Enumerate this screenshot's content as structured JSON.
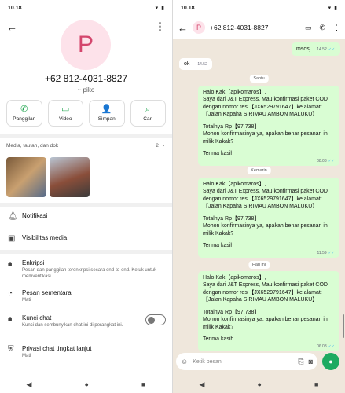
{
  "left": {
    "status": {
      "time": "10.18"
    },
    "avatar_letter": "P",
    "phone": "+62 812-4031-8827",
    "alias": "~ piko",
    "actions": [
      {
        "icon": "phone-icon",
        "glyph": "✆",
        "label": "Panggilan"
      },
      {
        "icon": "video-icon",
        "glyph": "▭",
        "label": "Video"
      },
      {
        "icon": "add-contact-icon",
        "glyph": "👤",
        "label": "Simpan"
      },
      {
        "icon": "search-icon",
        "glyph": "⌕",
        "label": "Cari"
      }
    ],
    "media": {
      "label": "Media, tautan, dan dok",
      "count": "2"
    },
    "settings": [
      {
        "icon": "bell-icon",
        "title": "Notifikasi",
        "subtitle": ""
      },
      {
        "icon": "image-icon",
        "title": "Visibilitas media",
        "subtitle": ""
      },
      {
        "icon": "lock-icon",
        "title": "Enkripsi",
        "subtitle": "Pesan dan panggilan terenkripsi secara end-to-end. Ketuk untuk memverifikasi."
      },
      {
        "icon": "timer-icon",
        "title": "Pesan sementara",
        "subtitle": "Mati"
      },
      {
        "icon": "chat-lock-icon",
        "title": "Kunci chat",
        "subtitle": "Kunci dan sembunyikan chat ini di perangkat ini."
      },
      {
        "icon": "shield-icon",
        "title": "Privasi chat tingkat lanjut",
        "subtitle": "Mati"
      }
    ]
  },
  "right": {
    "status": {
      "time": "10.18"
    },
    "contact": "+62 812-4031-8827",
    "avatar_letter": "P",
    "messages": {
      "m1": {
        "text": "msosj",
        "time": "14.52"
      },
      "m2": {
        "text": "ok",
        "time": "14.52"
      },
      "date1": "Sabtu",
      "date2": "Kemarin",
      "date3": "Hari ini",
      "order_greeting": "Halo Kak【apikomaros】,",
      "order_line1": "Saya dari J&T Express, Mau konfirmasi paket COD dengan nomor resi【JX6529791647】ke alamat:",
      "order_line2": "【Jalan Kapaha  SIRIMAU AMBON MALUKU】",
      "order_total": "Totalnya Rp【97,738】",
      "order_q": "Mohon konfirmasinya ya, apakah benar pesanan ini milik Kakak?",
      "order_thanks": "Terima kasih",
      "t1": "08.03",
      "t2": "11.59",
      "t3": "06.08"
    },
    "composer_placeholder": "Ketik pesan"
  }
}
